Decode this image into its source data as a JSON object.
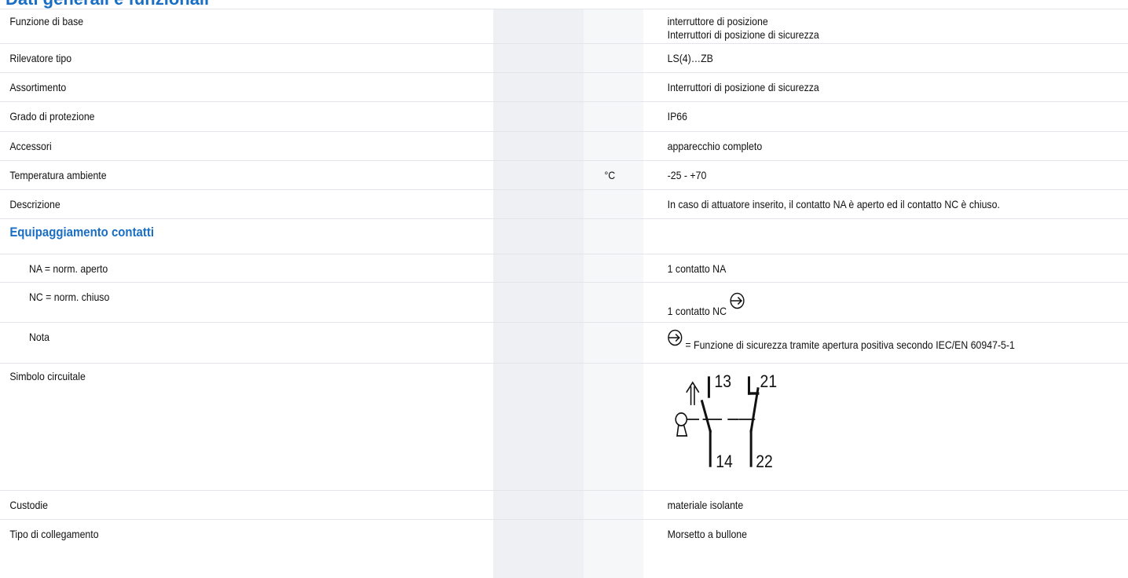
{
  "header": {
    "title": "Dati generali e funzionali"
  },
  "rows": [
    {
      "label": "Funzione di base",
      "unit": "",
      "value": "interruttore di posizione",
      "value2": "Interruttori di posizione di sicurezza"
    },
    {
      "label": "Rilevatore tipo",
      "unit": "",
      "value": "LS(4)…ZB"
    },
    {
      "label": "Assortimento",
      "unit": "",
      "value": "Interruttori di posizione di sicurezza"
    },
    {
      "label": "Grado di protezione",
      "unit": "",
      "value": "IP66"
    },
    {
      "label": "Accessori",
      "unit": "",
      "value": "apparecchio completo"
    },
    {
      "label": "Temperatura ambiente",
      "unit": "°C",
      "value": "-25 - +70"
    },
    {
      "label": "Descrizione",
      "unit": "",
      "value": "In caso di attuatore inserito, il contatto NA è aperto ed il contatto NC è chiuso."
    }
  ],
  "section": {
    "title": "Equipaggiamento contatti"
  },
  "contacts": [
    {
      "label": "NA = norm. aperto",
      "value": "1 contatto NA"
    },
    {
      "label": "NC = norm. chiuso",
      "value": "1 contatto NC"
    },
    {
      "label": "Nota",
      "value": "= Funzione di sicurezza tramite apertura positiva secondo IEC/EN 60947-5-1"
    }
  ],
  "circuit": {
    "label": "Simbolo circuitale",
    "terminals": {
      "t13": "13",
      "t14": "14",
      "t21": "21",
      "t22": "22"
    }
  },
  "tail_rows": [
    {
      "label": "Custodie",
      "value": "materiale isolante"
    },
    {
      "label": "Tipo di collegamento",
      "value": "Morsetto a bullone"
    }
  ]
}
